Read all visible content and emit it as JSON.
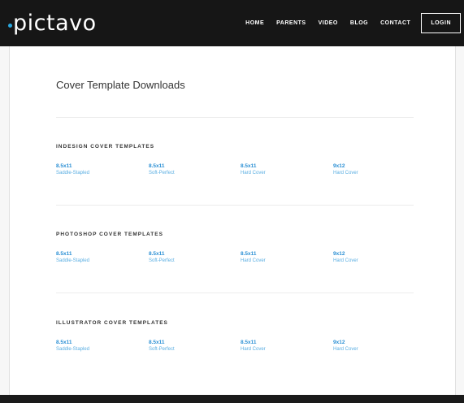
{
  "brand": {
    "logo_text": "pictavo",
    "accent": "#29a8e0"
  },
  "nav": {
    "items": [
      "HOME",
      "PARENTS",
      "VIDEO",
      "BLOG",
      "CONTACT"
    ],
    "login_label": "LOGIN"
  },
  "page_title": "Cover Template Downloads",
  "sections": [
    {
      "title": "INDESIGN COVER TEMPLATES",
      "templates": [
        {
          "size": "8.5x11",
          "type": "Saddle-Stapled"
        },
        {
          "size": "8.5x11",
          "type": "Soft-Perfect"
        },
        {
          "size": "8.5x11",
          "type": "Hard Cover"
        },
        {
          "size": "9x12",
          "type": "Hard Cover"
        }
      ]
    },
    {
      "title": "PHOTOSHOP COVER TEMPLATES",
      "templates": [
        {
          "size": "8.5x11",
          "type": "Saddle-Stapled"
        },
        {
          "size": "8.5x11",
          "type": "Soft-Perfect"
        },
        {
          "size": "8.5x11",
          "type": "Hard Cover"
        },
        {
          "size": "9x12",
          "type": "Hard Cover"
        }
      ]
    },
    {
      "title": "ILLUSTRATOR COVER TEMPLATES",
      "templates": [
        {
          "size": "8.5x11",
          "type": "Saddle-Stapled"
        },
        {
          "size": "8.5x11",
          "type": "Soft-Perfect"
        },
        {
          "size": "8.5x11",
          "type": "Hard Cover"
        },
        {
          "size": "9x12",
          "type": "Hard Cover"
        }
      ]
    }
  ]
}
